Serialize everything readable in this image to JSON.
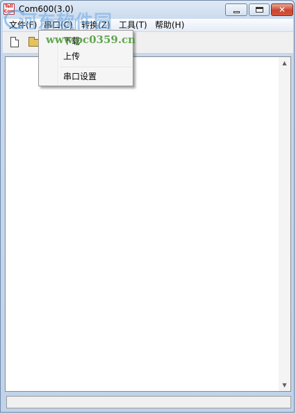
{
  "window": {
    "title": "Com600(3.0)",
    "icon_text_top": "Tell",
    "icon_text_bottom": "Com"
  },
  "menubar": {
    "items": [
      {
        "label": "文件(F)"
      },
      {
        "label": "串口(C)"
      },
      {
        "label": "转换(Z)"
      },
      {
        "label": "工具(T)"
      },
      {
        "label": "帮助(H)"
      }
    ]
  },
  "dropdown": {
    "items": [
      {
        "label": "下载"
      },
      {
        "label": "上传"
      },
      {
        "label": "串口设置"
      }
    ]
  },
  "watermark": {
    "site_name": "河东软件园",
    "url": "www.pc0359.cn"
  },
  "icons": {
    "new": "new-file-icon",
    "open": "open-folder-icon"
  },
  "colors": {
    "title_bar": "#c8d9ee",
    "close_button": "#c9462e",
    "menu_highlight": "#dce8f6"
  }
}
